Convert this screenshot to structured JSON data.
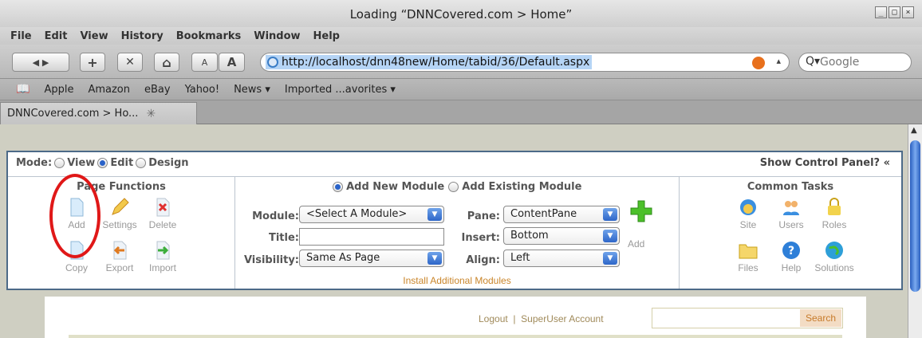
{
  "window": {
    "title": "Loading “DNNCovered.com > Home”",
    "controls": [
      "_",
      "□",
      "×"
    ]
  },
  "menu": [
    "File",
    "Edit",
    "View",
    "History",
    "Bookmarks",
    "Window",
    "Help"
  ],
  "toolbar": {
    "back_fwd": "◀ ▶",
    "plus": "+",
    "stop": "✕",
    "home": "⌂",
    "text_small": "A",
    "text_large": "A",
    "url": "http://localhost/dnn48new/Home/tabid/36/Default.aspx",
    "search_placeholder": "Google",
    "search_glyph": "Q▾",
    "chev": "▴"
  },
  "bookmarks": {
    "book": "🕮",
    "items": [
      "Apple",
      "Amazon",
      "eBay",
      "Yahoo!",
      "News ▾",
      "Imported ...avorites ▾"
    ]
  },
  "tab": {
    "label": "DNNCovered.com > Ho...",
    "spinner": "✳"
  },
  "control_panel": {
    "mode_label": "Mode:",
    "modes": [
      "View",
      "Edit",
      "Design"
    ],
    "selected_mode": "Edit",
    "show_cp": "Show Control Panel? «",
    "page_functions": {
      "title": "Page Functions",
      "items": [
        "Add",
        "Settings",
        "Delete",
        "Copy",
        "Export",
        "Import"
      ]
    },
    "module": {
      "add_new": "Add New Module",
      "add_existing": "Add Existing Module",
      "module_label": "Module:",
      "module_value": "<Select A Module>",
      "title_label": "Title:",
      "title_value": "",
      "visibility_label": "Visibility:",
      "visibility_value": "Same As Page",
      "pane_label": "Pane:",
      "pane_value": "ContentPane",
      "insert_label": "Insert:",
      "insert_value": "Bottom",
      "align_label": "Align:",
      "align_value": "Left",
      "add": "Add",
      "install": "Install Additional Modules",
      "arrow": "▼"
    },
    "common_tasks": {
      "title": "Common Tasks",
      "items": [
        "Site",
        "Users",
        "Roles",
        "Files",
        "Help",
        "Solutions"
      ]
    }
  },
  "page": {
    "logout": "Logout",
    "separator": "|",
    "account": "SuperUser Account",
    "search_button": "Search"
  },
  "scroll": {
    "up": "▲"
  },
  "colors": {
    "accent": "#2e66c9",
    "highlight_circle": "#e01818",
    "link": "#c9852a"
  }
}
